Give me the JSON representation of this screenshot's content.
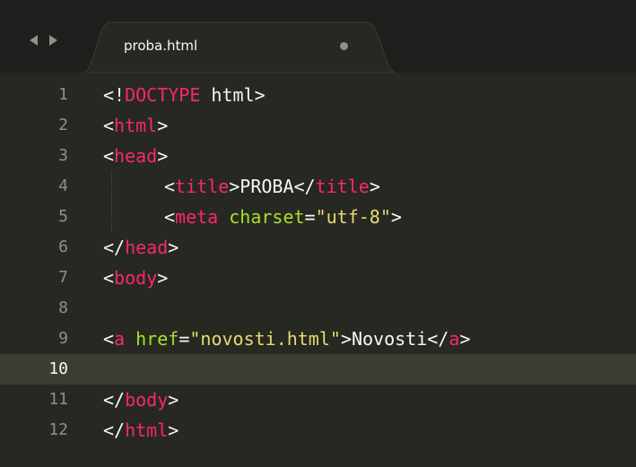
{
  "window": {
    "theme_colors": {
      "background": "#272822",
      "tabbar": "#1e1f1c",
      "tag": "#f92672",
      "attribute": "#a6e22e",
      "string": "#e6db74",
      "text": "#f8f8f2",
      "gutter": "#90908a"
    }
  },
  "tab": {
    "title": "proba.html",
    "status_icon": "unsaved-dot-icon"
  },
  "nav": {
    "back_icon": "arrow-left-icon",
    "forward_icon": "arrow-right-icon"
  },
  "editor": {
    "active_line": 10,
    "lines": [
      {
        "num": "1",
        "p1": "<!",
        "tag": "DOCTYPE",
        "rest": " html>"
      },
      {
        "num": "2",
        "open": "<",
        "tag": "html",
        "close": ">"
      },
      {
        "num": "3",
        "open": "<",
        "tag": "head",
        "close": ">"
      },
      {
        "num": "4",
        "open": "<",
        "tag": "title",
        "mid": ">PROBA</",
        "tag2": "title",
        "close": ">"
      },
      {
        "num": "5",
        "open": "<",
        "tag": "meta",
        "attr": " charset",
        "eq": "=",
        "str": "\"utf-8\"",
        "close": ">"
      },
      {
        "num": "6",
        "open": "</",
        "tag": "head",
        "close": ">"
      },
      {
        "num": "7",
        "open": "<",
        "tag": "body",
        "close": ">"
      },
      {
        "num": "8"
      },
      {
        "num": "9",
        "open": "<",
        "tag": "a",
        "attr": " href",
        "eq": "=",
        "str": "\"novosti.html\"",
        "mid": ">Novosti</",
        "tag2": "a",
        "close": ">"
      },
      {
        "num": "10"
      },
      {
        "num": "11",
        "open": "</",
        "tag": "body",
        "close": ">"
      },
      {
        "num": "12",
        "open": "</",
        "tag": "html",
        "close": ">"
      }
    ]
  }
}
